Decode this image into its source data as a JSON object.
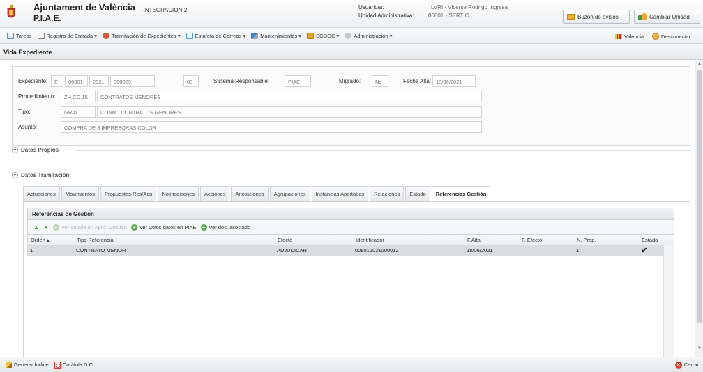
{
  "header": {
    "title": "Ajuntament de València",
    "subtitle": "P.I.A.E.",
    "environment": "-INTEGRACIÓN-2-",
    "user_label": "Usuario/a:",
    "user_value": "LVRI - Vicente Rodrigo Ingresa",
    "unit_label": "Unidad Administrativa:",
    "unit_value": "00801 - SERTIC",
    "buzon_button": "Buzón de avisos",
    "unidad_button": "Cambiar Unidad"
  },
  "menu": {
    "items": [
      {
        "label": "Tareas",
        "icon": "calendar-icon",
        "color": "#4a8fd0"
      },
      {
        "label": "Registro de Entrada ▾",
        "icon": "register-icon",
        "color": "#7a7a7a"
      },
      {
        "label": "Tramitación de Expedientes ▾",
        "icon": "gears-icon",
        "color": "#d05a3a"
      },
      {
        "label": "Estafeta de Correos ▾",
        "icon": "mail-icon",
        "color": "#5a9fd8"
      },
      {
        "label": "Mantenimientos ▾",
        "icon": "tools-icon",
        "color": "#3a7fc8"
      },
      {
        "label": "SGDOC ▾",
        "icon": "folder-icon",
        "color": "#e8a820"
      },
      {
        "label": "Administración ▾",
        "icon": "admin-gear-icon",
        "color": "#9aa0a6"
      }
    ],
    "valencia": "Valencià",
    "disconnect": "Desconectar"
  },
  "section_title": "Vida Expediente",
  "form": {
    "expediente_label": "Expediente:",
    "expediente": [
      "E",
      "00801",
      "2021",
      "000029",
      "00"
    ],
    "sistema_label": "Sistema Responsable:",
    "sistema_value": "PIAE",
    "migrado_label": "Migrado:",
    "migrado_value": "No",
    "fecha_alta_label": "Fecha Alta:",
    "fecha_alta_value": "18/06/2021",
    "procedimiento_label": "Procedimiento:",
    "procedimiento_code": "ZH.CO.15",
    "procedimiento_desc": "CONTRATOS MENORES",
    "tipo_label": "Tipo:",
    "tipo_code": "GRAL.",
    "tipo_code2": "CONM",
    "tipo_desc": "CONTRATOS MENORES",
    "asunto_label": "Asunto:",
    "asunto_value": "COMPRA DE 3 IMPRESORAS COLOR"
  },
  "datos_propios": "Datos Propios",
  "datos_tramitacion": "Datos Tramitación",
  "tabs": [
    "Actuaciones",
    "Movimientos",
    "Propuestas Res/Acu",
    "Notificaciones",
    "Acciones",
    "Anotaciones",
    "Agrupaciones",
    "Instancias Aportadas",
    "Relaciones",
    "Estado",
    "Referencias Gestión"
  ],
  "grid": {
    "title": "Referencias de Gestión",
    "toolbar": {
      "detalle": "Ver detalle en Aplic. Gestión",
      "otros": "Ver Otros datos en PIAE",
      "doc": "Ver doc. asociado"
    },
    "columns": [
      "Orden ▴",
      "Tipo Referencia",
      "Efecto",
      "Identificador",
      "F.Alta",
      "F. Efecto",
      "N. Prop.",
      "Estado"
    ],
    "rows": [
      {
        "orden": "1",
        "tipo": "CONTRATO MENOR",
        "efecto": "ADJUDICAR",
        "identificador": "008012021000012",
        "falta": "18/06/2021",
        "fefecto": "",
        "nprop": "1",
        "estado_icon": "checkmark-icon"
      }
    ]
  },
  "footer": {
    "generar_indice": "Generar Índice",
    "caratula": "Carátula D.C.",
    "cerrar": "Cerrar"
  }
}
